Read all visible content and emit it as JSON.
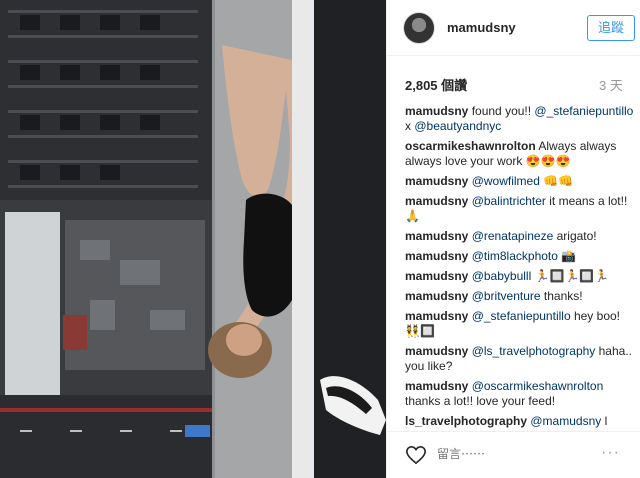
{
  "post": {
    "username": "mamudsny",
    "follow_label": "追蹤",
    "likes": "2,805 個讚",
    "time_ago": "3 天"
  },
  "comments": [
    {
      "user": "mamudsny",
      "parts": [
        {
          "type": "text",
          "value": "found you!! "
        },
        {
          "type": "mention",
          "value": "@_stefaniepuntillo"
        },
        {
          "type": "text",
          "value": " x "
        },
        {
          "type": "mention",
          "value": "@beautyandnyc"
        }
      ]
    },
    {
      "user": "oscarmikeshawnrolton",
      "parts": [
        {
          "type": "text",
          "value": "Always always always love your work 😍😍😍"
        }
      ]
    },
    {
      "user": "mamudsny",
      "parts": [
        {
          "type": "mention",
          "value": "@wowfilmed"
        },
        {
          "type": "text",
          "value": " 👊👊"
        }
      ]
    },
    {
      "user": "mamudsny",
      "parts": [
        {
          "type": "mention",
          "value": "@balintrichter"
        },
        {
          "type": "text",
          "value": " it means a lot!! 🙏"
        }
      ]
    },
    {
      "user": "mamudsny",
      "parts": [
        {
          "type": "mention",
          "value": "@renatapineze"
        },
        {
          "type": "text",
          "value": " arigato!"
        }
      ]
    },
    {
      "user": "mamudsny",
      "parts": [
        {
          "type": "mention",
          "value": "@tim8lackphoto"
        },
        {
          "type": "text",
          "value": " 📸"
        }
      ]
    },
    {
      "user": "mamudsny",
      "parts": [
        {
          "type": "mention",
          "value": "@babybulll"
        },
        {
          "type": "text",
          "value": " 🏃🔲🏃🔲🏃"
        }
      ]
    },
    {
      "user": "mamudsny",
      "parts": [
        {
          "type": "mention",
          "value": "@britventure"
        },
        {
          "type": "text",
          "value": " thanks!"
        }
      ]
    },
    {
      "user": "mamudsny",
      "parts": [
        {
          "type": "mention",
          "value": "@_stefaniepuntillo"
        },
        {
          "type": "text",
          "value": " hey boo! 👯🔲"
        }
      ]
    },
    {
      "user": "mamudsny",
      "parts": [
        {
          "type": "mention",
          "value": "@ls_travelphotography"
        },
        {
          "type": "text",
          "value": " haha.. you like?"
        }
      ]
    },
    {
      "user": "mamudsny",
      "parts": [
        {
          "type": "mention",
          "value": "@oscarmikeshawnrolton"
        },
        {
          "type": "text",
          "value": " thanks a lot!! love your feed!"
        }
      ]
    },
    {
      "user": "ls_travelphotography",
      "parts": [
        {
          "type": "mention",
          "value": "@mamudsny"
        },
        {
          "type": "text",
          "value": " l"
        }
      ]
    }
  ],
  "composer": {
    "placeholder": "留言⋯⋯",
    "more_label": "···"
  },
  "icons": {
    "like": "heart-icon",
    "more": "more-options-icon"
  },
  "colors": {
    "accent": "#3897f0",
    "mention": "#003569",
    "muted": "#999999"
  }
}
